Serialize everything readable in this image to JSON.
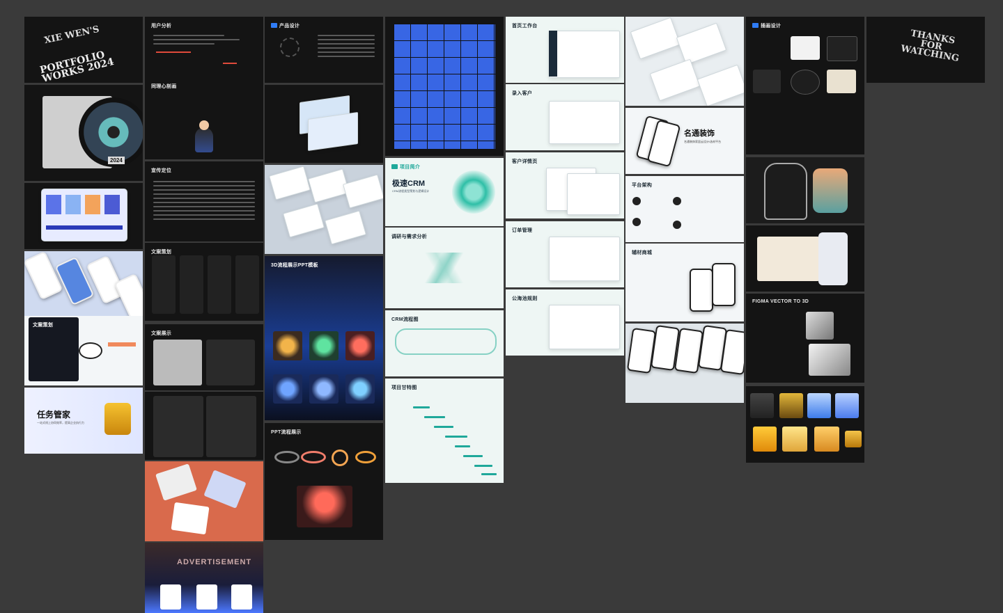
{
  "frames": {
    "cover": {
      "art_text": "PORTFOLIO WORKS 2024",
      "art_text2": "XIE WEN'S"
    },
    "user_analysis": {
      "title": "用户分析"
    },
    "empathy_map": {
      "title": "同理心剖画"
    },
    "copy_planning": {
      "title": "文案策划"
    },
    "project_design": {
      "title": "产品设计"
    },
    "ppt_3d": {
      "title": "3D流程展示PPT模板"
    },
    "ppt_flow": {
      "title": "PPT流程展示"
    },
    "project_intro": {
      "title": "项目简介",
      "crm_title": "极速CRM",
      "crm_sub": "CRM流程类型策划与逻辑设计"
    },
    "research": {
      "title": "调研与需求分析"
    },
    "crm_flow": {
      "title": "CRM流程图"
    },
    "gantt": {
      "title": "项目甘特图"
    },
    "home_workbench": {
      "title": "首页工作台"
    },
    "enter_customer": {
      "title": "录入客户"
    },
    "customer_detail": {
      "title": "客户详情页"
    },
    "order_mgmt": {
      "title": "订单管理"
    },
    "public_pool": {
      "title": "公海池规则"
    },
    "decor_title": {
      "title": "名通装饰",
      "sub": "名通装饰家居云设计/选材平台"
    },
    "platform_arch": {
      "title": "平台架构"
    },
    "aux_mall": {
      "title": "辅材商城"
    },
    "illustration": {
      "title": "插画设计"
    },
    "figma_3d": {
      "title": "FIGMA VECTOR TO 3D"
    },
    "thanks": {
      "art_text": "THANKS FOR WATCHING"
    },
    "copy_planning2": {
      "title": "文案策划"
    },
    "task_manager": {
      "title": "任务管家",
      "sub": "一站式线上协同效率，提高企业执行力"
    },
    "copy_show": {
      "title": "文案展示"
    },
    "advertisement": {
      "title": "ADVERTISEMENT"
    },
    "copy_position": {
      "title": "宣传定位"
    },
    "album": {
      "year": "2024"
    }
  }
}
